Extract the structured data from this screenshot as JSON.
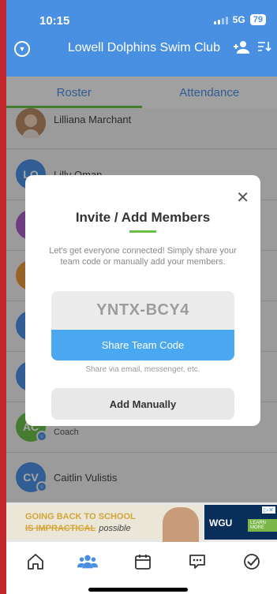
{
  "status": {
    "time": "10:15",
    "network": "5G",
    "battery": "79"
  },
  "header": {
    "title": "Lowell Dolphins Swim Club"
  },
  "tabs": [
    {
      "label": "Roster"
    },
    {
      "label": "Attendance"
    }
  ],
  "roster": [
    {
      "initials": "",
      "name": "Lilliana Marchant",
      "color": "#c9a27a",
      "sub": ""
    },
    {
      "initials": "LO",
      "name": "Lilly Oman",
      "color": "#4a90e2",
      "sub": ""
    },
    {
      "initials": "M",
      "name": "",
      "color": "#a65fc4",
      "sub": ""
    },
    {
      "initials": "C",
      "name": "",
      "color": "#e8973a",
      "sub": ""
    },
    {
      "initials": "",
      "name": "",
      "color": "#4a90e2",
      "sub": ""
    },
    {
      "initials": "",
      "name": "",
      "color": "#4a90e2",
      "sub": ""
    },
    {
      "initials": "AC",
      "name": "",
      "color": "#6abf4b",
      "sub": "Coach"
    },
    {
      "initials": "CV",
      "name": "Caitlin Vulistis",
      "color": "#4a90e2",
      "sub": ""
    }
  ],
  "modal": {
    "title": "Invite / Add Members",
    "description": "Let's get everyone connected! Simply share your team code or manually add your members.",
    "team_code": "YNTX-BCY4",
    "share_label": "Share Team Code",
    "share_hint": "Share via email, messenger, etc.",
    "manual_label": "Add Manually"
  },
  "ad": {
    "line1": "GOING BACK TO SCHOOL",
    "line2_strike": "IS IMPRACTICAL",
    "line2_script": "possible",
    "brand": "WGU",
    "cta": "LEARN MORE"
  }
}
